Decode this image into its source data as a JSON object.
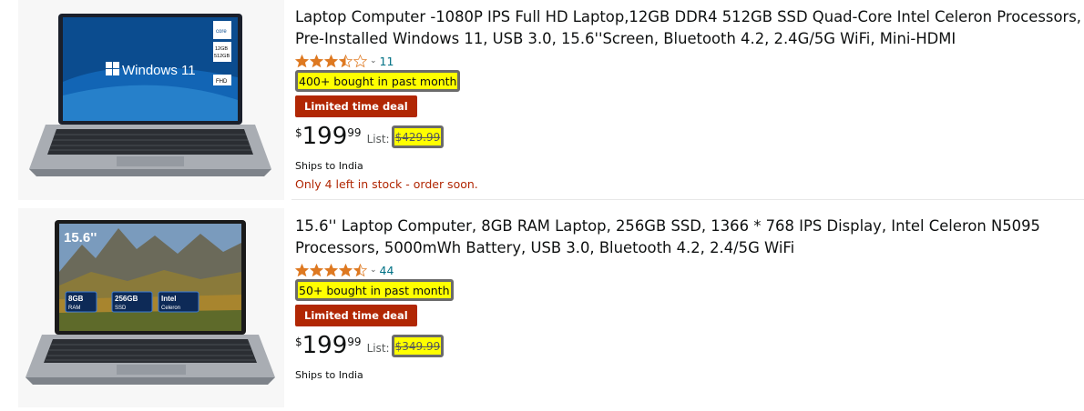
{
  "products": [
    {
      "title_line1": "Laptop Computer -1080P IPS Full HD Laptop,12GB DDR4 512GB SSD Quad-Core Intel Celeron Processors,",
      "title_line2": "Pre-Installed Windows 11, USB 3.0, 15.6''Screen, Bluetooth 4.2, 2.4G/5G WiFi, Mini-HDMI",
      "rating_stars": 3.5,
      "rating_count": "11",
      "bought": "400+ bought in past month",
      "deal": "Limited time deal",
      "price_symbol": "$",
      "price_whole": "199",
      "price_fraction": "99",
      "list_label": "List:",
      "list_price": "$429.99",
      "ships": "Ships to India",
      "stock": "Only 4 left in stock - order soon.",
      "image": {
        "screen_text": "Windows 11",
        "badge1": "core",
        "badge2": "12GB",
        "badge3": "512GB",
        "badge4": "FHD"
      }
    },
    {
      "title_line1": "15.6'' Laptop Computer, 8GB RAM Laptop, 256GB SSD, 1366 * 768 IPS Display, Intel Celeron N5095",
      "title_line2": "Processors, 5000mWh Battery, USB 3.0, Bluetooth 4.2, 2.4/5G WiFi",
      "rating_stars": 4.5,
      "rating_count": "44",
      "bought": "50+ bought in past month",
      "deal": "Limited time deal",
      "price_symbol": "$",
      "price_whole": "199",
      "price_fraction": "99",
      "list_label": "List:",
      "list_price": "$349.99",
      "ships": "Ships to India",
      "image": {
        "screen_text": "15.6''",
        "chip1_top": "8GB",
        "chip1_bottom": "RAM",
        "chip2_top": "256GB",
        "chip2_bottom": "SSD",
        "chip3_top": "Intel",
        "chip3_bottom": "Celeron"
      }
    }
  ],
  "colors": {
    "star": "#de7921",
    "deal_bg": "#b12704",
    "link": "#007185",
    "highlight": "#ffff00"
  }
}
